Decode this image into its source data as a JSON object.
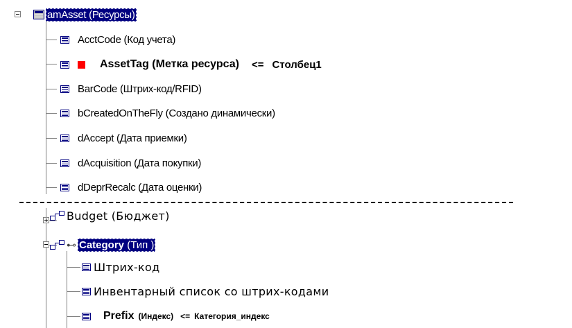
{
  "root": {
    "label": "amAsset (Ресурсы)"
  },
  "fields": [
    {
      "label": "AcctCode (Код учета)"
    },
    {
      "label": "AssetTag (Метка ресурса)",
      "arrow": "<=",
      "target": "Столбец1"
    },
    {
      "label": "BarCode (Штрих-код/RFID)"
    },
    {
      "label": "bCreatedOnTheFly (Создано динамически)"
    },
    {
      "label": "dAccept (Дата приемки)"
    },
    {
      "label": "dAcquisition (Дата покупки)"
    },
    {
      "label": "dDeprRecalc (Дата оценки)"
    }
  ],
  "links": [
    {
      "label": "Budget (Бюджет)"
    },
    {
      "label_bold": "Category",
      "label_rest": " (Тип )"
    }
  ],
  "category_children": [
    {
      "label": "Штрих-код"
    },
    {
      "label": "Инвентарный список со штрих-кодами"
    },
    {
      "label": "Prefix",
      "hint": "(Индекс)",
      "arrow": "<=",
      "target": "Категория_индекс"
    }
  ],
  "colors": {
    "selection": "#000080",
    "mapped_marker": "#ff0000",
    "tree_lines": "#808080"
  }
}
